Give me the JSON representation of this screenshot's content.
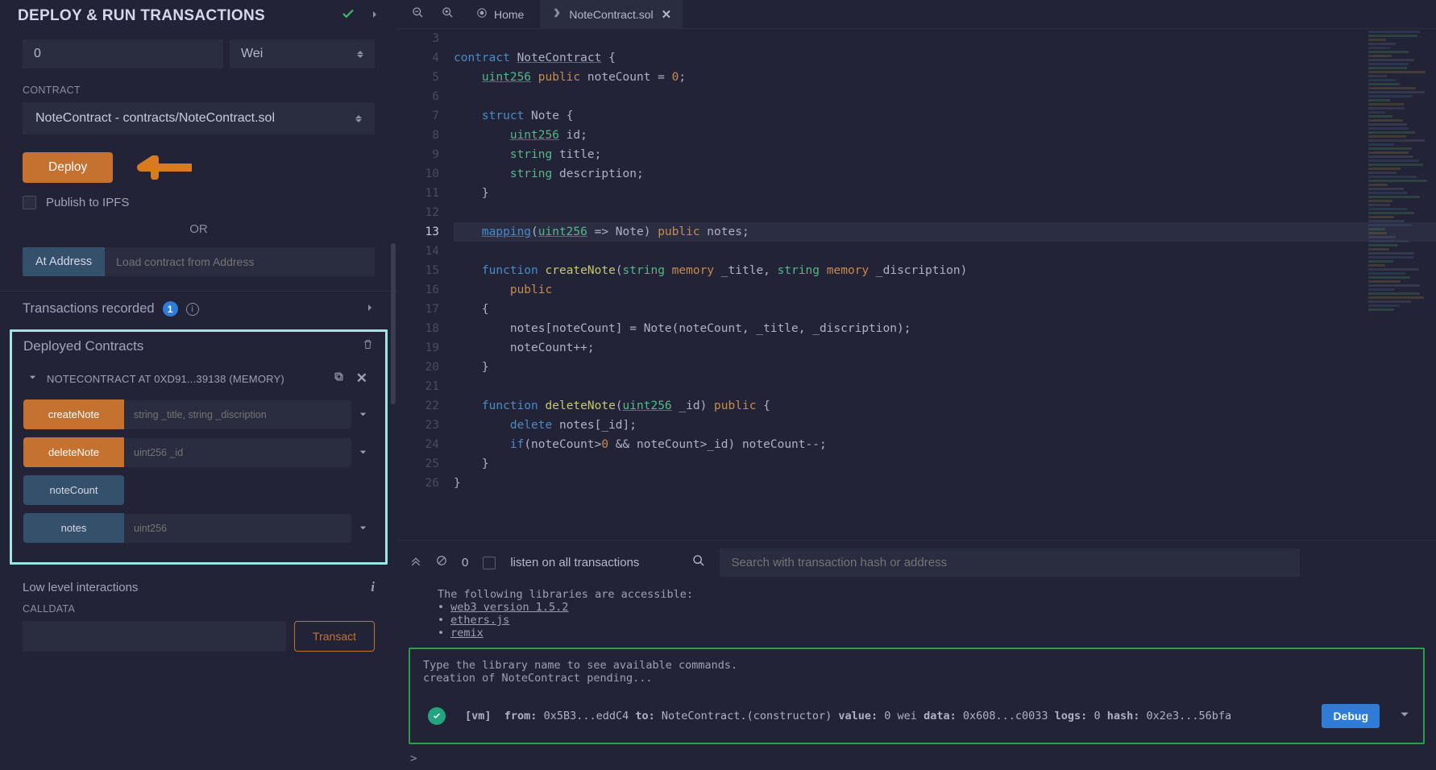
{
  "panel": {
    "title": "DEPLOY & RUN TRANSACTIONS",
    "value_input": "0",
    "unit": "Wei",
    "contract_label": "CONTRACT",
    "contract_selected": "NoteContract - contracts/NoteContract.sol",
    "deploy_btn": "Deploy",
    "publish_label": "Publish to IPFS",
    "or": "OR",
    "at_address_btn": "At Address",
    "at_address_placeholder": "Load contract from Address",
    "tx_recorded_label": "Transactions recorded",
    "tx_recorded_count": "1",
    "deployed_title": "Deployed Contracts",
    "instance_name": "NOTECONTRACT AT 0XD91...39138 (MEMORY)",
    "functions": [
      {
        "name": "createNote",
        "placeholder": "string _title, string _discription",
        "style": "orange",
        "has_input": true
      },
      {
        "name": "deleteNote",
        "placeholder": "uint256 _id",
        "style": "orange",
        "has_input": true
      },
      {
        "name": "noteCount",
        "placeholder": "",
        "style": "blue",
        "has_input": false
      },
      {
        "name": "notes",
        "placeholder": "uint256",
        "style": "blue",
        "has_input": true
      }
    ],
    "lowlevel_title": "Low level interactions",
    "calldata_label": "CALLDATA",
    "transact_btn": "Transact"
  },
  "tabs": {
    "home": "Home",
    "file": "NoteContract.sol"
  },
  "code_lines": [
    {
      "n": 3,
      "html": ""
    },
    {
      "n": 4,
      "html": "<span class=\"kw\">contract</span> <span class=\"identU\">NoteContract</span> {"
    },
    {
      "n": 5,
      "html": "    <span class=\"typeu\">uint256</span> <span class=\"pub\">public</span> noteCount = <span class=\"num\">0</span>;"
    },
    {
      "n": 6,
      "html": ""
    },
    {
      "n": 7,
      "html": "    <span class=\"kw\">struct</span> <span class=\"ident\">Note</span> {"
    },
    {
      "n": 8,
      "html": "        <span class=\"typeu\">uint256</span> id;"
    },
    {
      "n": 9,
      "html": "        <span class=\"type\">string</span> title;"
    },
    {
      "n": 10,
      "html": "        <span class=\"type\">string</span> description;"
    },
    {
      "n": 11,
      "html": "    }"
    },
    {
      "n": 12,
      "html": ""
    },
    {
      "n": 13,
      "hl": true,
      "html": "    <span class=\"kwu\">mapping</span>(<span class=\"typeu\">uint256</span> =&gt; Note) <span class=\"pub\">public</span> notes;"
    },
    {
      "n": 14,
      "html": ""
    },
    {
      "n": 15,
      "html": "    <span class=\"kw\">function</span> <span class=\"fn\">createNote</span>(<span class=\"type\">string</span> <span class=\"mem\">memory</span> _title, <span class=\"type\">string</span> <span class=\"mem\">memory</span> _discription)"
    },
    {
      "n": 16,
      "html": "        <span class=\"pub\">public</span>"
    },
    {
      "n": 17,
      "html": "    {"
    },
    {
      "n": 18,
      "html": "        notes[noteCount] = Note(noteCount, _title, _discription);"
    },
    {
      "n": 19,
      "html": "        noteCount++;"
    },
    {
      "n": 20,
      "html": "    }"
    },
    {
      "n": 21,
      "html": ""
    },
    {
      "n": 22,
      "html": "    <span class=\"kw\">function</span> <span class=\"fn\">deleteNote</span>(<span class=\"typeu\">uint256</span> _id) <span class=\"pub\">public</span> {"
    },
    {
      "n": 23,
      "html": "        <span class=\"kw\">delete</span> notes[_id];"
    },
    {
      "n": 24,
      "html": "        <span class=\"kw\">if</span>(noteCount&gt;<span class=\"num\">0</span> &amp;&amp; noteCount&gt;_id) noteCount--;"
    },
    {
      "n": 25,
      "html": "    }"
    },
    {
      "n": 26,
      "html": "}"
    }
  ],
  "terminal": {
    "zero": "0",
    "listen_label": "listen on all transactions",
    "search_placeholder": "Search with transaction hash or address",
    "intro_line": "The following libraries are accessible:",
    "libs": [
      "web3 version 1.5.2",
      "ethers.js",
      "remix"
    ],
    "tip1": "Type the library name to see available commands.",
    "tip2": "creation of NoteContract pending...",
    "tx": {
      "vm": "[vm]",
      "from_lbl": "from:",
      "from": "0x5B3...eddC4",
      "to_lbl": "to:",
      "to": "NoteContract.(constructor)",
      "value_lbl": "value:",
      "value": "0 wei",
      "data_lbl": "data:",
      "data": "0x608...c0033",
      "logs_lbl": "logs:",
      "logs": "0",
      "hash_lbl": "hash:",
      "hash": "0x2e3...56bfa"
    },
    "debug_btn": "Debug",
    "prompt": ">"
  }
}
